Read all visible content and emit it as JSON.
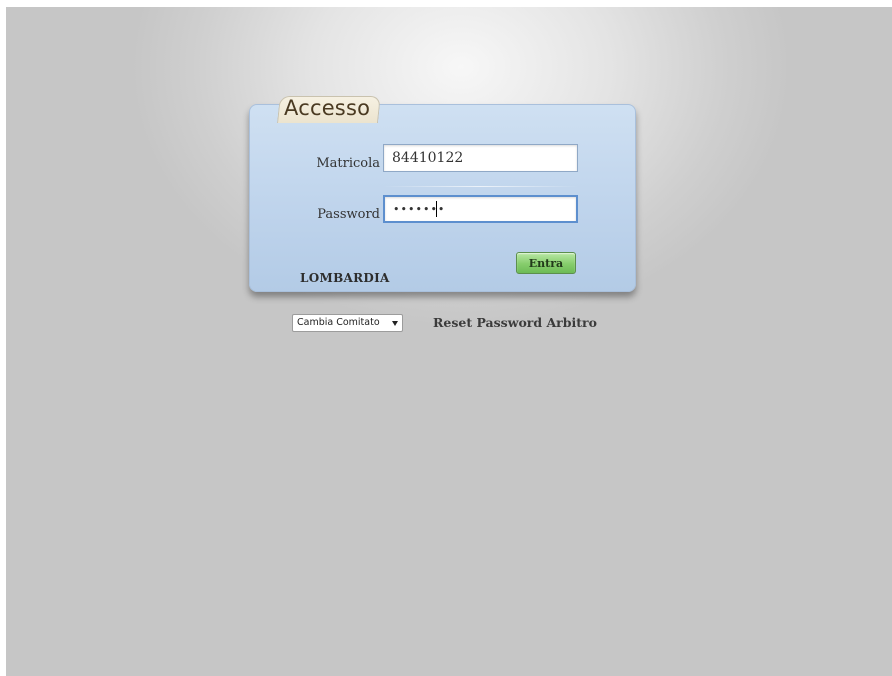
{
  "login_panel": {
    "tab_title": "Accesso",
    "matricola": {
      "label": "Matricola",
      "value": "84410122"
    },
    "password": {
      "label": "Password",
      "value": "•••••••"
    },
    "submit_label": "Entra",
    "region_name": "LOMBARDIA"
  },
  "footer": {
    "committee_select": {
      "selected": "Cambia Comitato"
    },
    "reset_link_label": "Reset Password Arbitro"
  },
  "colors": {
    "panel_background": "#c4d7ee",
    "submit_button": "#86cd6c",
    "page_background": "#c6c6c6"
  }
}
